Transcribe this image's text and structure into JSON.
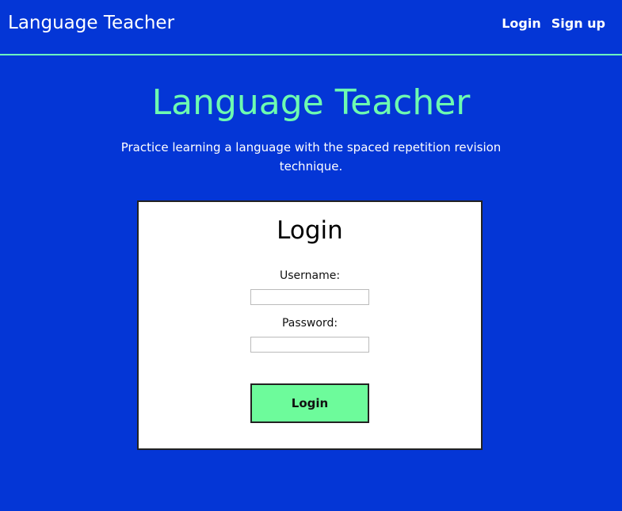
{
  "header": {
    "brand": "Language Teacher",
    "nav": {
      "login": "Login",
      "signup": "Sign up"
    }
  },
  "hero": {
    "title": "Language Teacher",
    "subtitle": "Practice learning a language with the spaced repetition revision technique."
  },
  "login_form": {
    "title": "Login",
    "username_label": "Username:",
    "username_value": "",
    "password_label": "Password:",
    "password_value": "",
    "submit_label": "Login"
  },
  "colors": {
    "background": "#0436d6",
    "accent": "#6dfbb0",
    "button": "#6dfb9b",
    "card": "#ffffff"
  }
}
